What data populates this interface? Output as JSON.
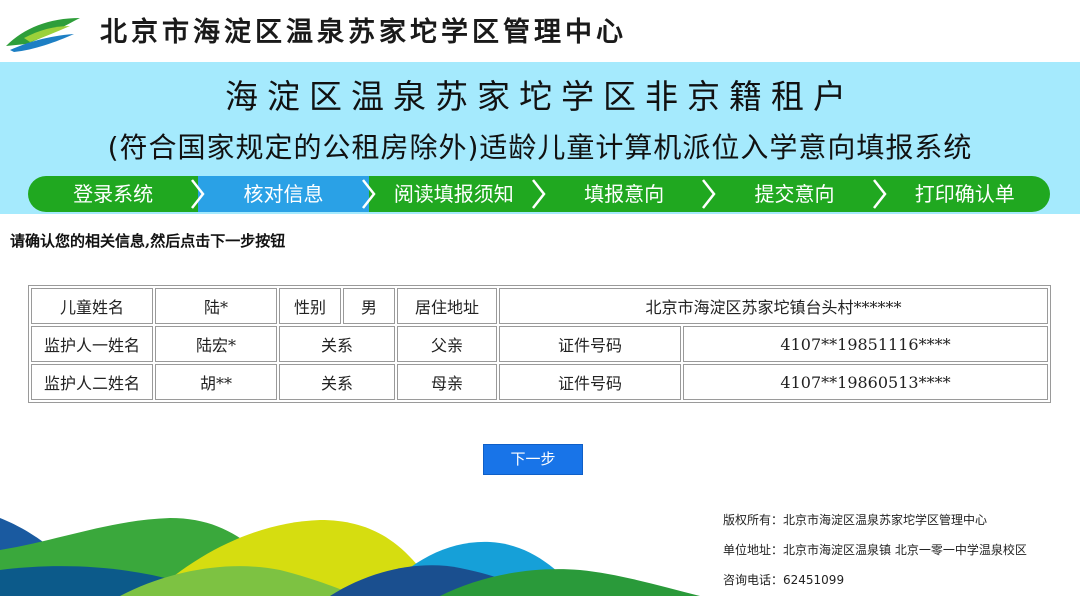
{
  "header": {
    "org_title": "北京市海淀区温泉苏家坨学区管理中心"
  },
  "banner": {
    "line1": "海淀区温泉苏家坨学区非京籍租户",
    "line2": "(符合国家规定的公租房除外)适龄儿童计算机派位入学意向填报系统"
  },
  "steps": [
    {
      "label": "登录系统"
    },
    {
      "label": "核对信息"
    },
    {
      "label": "阅读填报须知"
    },
    {
      "label": "填报意向"
    },
    {
      "label": "提交意向"
    },
    {
      "label": "打印确认单"
    }
  ],
  "active_step": "核对信息",
  "instruction": "请确认您的相关信息,然后点击下一步按钮",
  "info": {
    "row1": {
      "child_name_label": "儿童姓名",
      "child_name": "陆*",
      "gender_label": "性别",
      "gender": "男",
      "address_label": "居住地址",
      "address": "北京市海淀区苏家坨镇台头村******"
    },
    "row2": {
      "guardian_label": "监护人一姓名",
      "guardian_name": "陆宏*",
      "relation_label": "关系",
      "relation": "父亲",
      "id_label": "证件号码",
      "id_number": "4107**19851116****"
    },
    "row3": {
      "guardian_label": "监护人二姓名",
      "guardian_name": "胡**",
      "relation_label": "关系",
      "relation": "母亲",
      "id_label": "证件号码",
      "id_number": "4107**19860513****"
    }
  },
  "next_button": "下一步",
  "footer": {
    "copyright": "版权所有：北京市海淀区温泉苏家坨学区管理中心",
    "address": "单位地址：北京市海淀区温泉镇 北京一零一中学温泉校区",
    "phone": "咨询电话：62451099"
  },
  "colors": {
    "banner_bg": "#a5eafd",
    "steps_bg": "#20a820",
    "active_step_bg": "#2aa1e6",
    "button_bg": "#1874e8"
  }
}
